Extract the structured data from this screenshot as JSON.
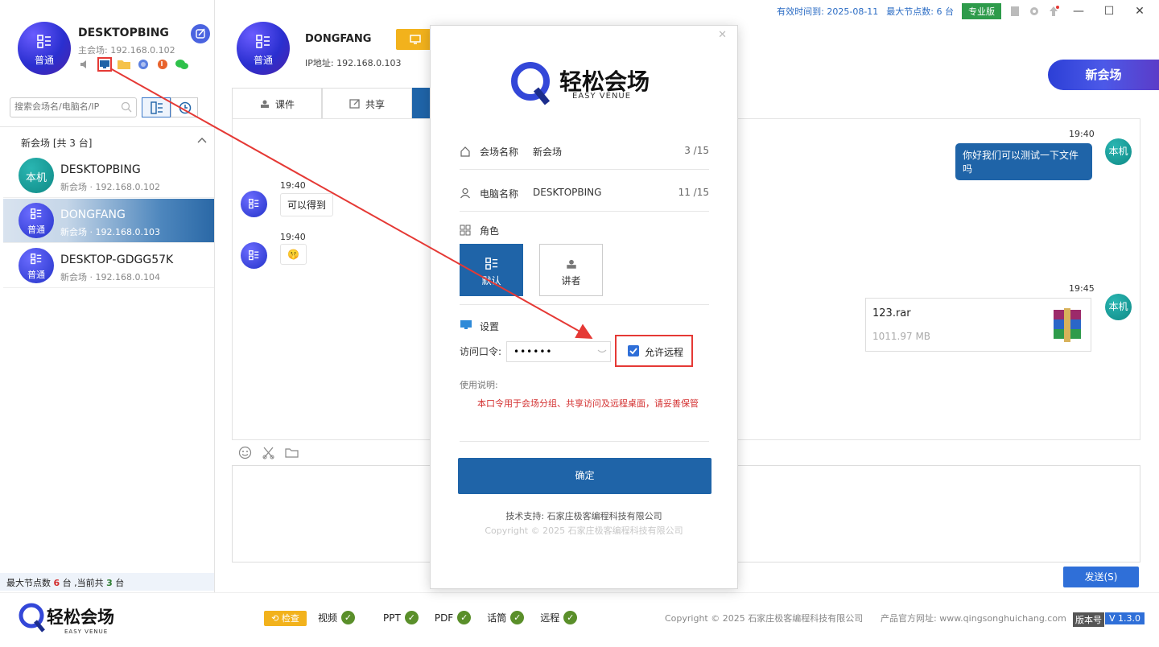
{
  "topbar": {
    "expiry": "有效时间到: 2025-08-11",
    "max_nodes": "最大节点数: 6 台",
    "edition": "专业版"
  },
  "host": {
    "name": "DESKTOPBING",
    "sub": "主会场: 192.168.0.102",
    "avatar_label": "普通"
  },
  "search": {
    "placeholder": "搜索会场名/电脑名/IP"
  },
  "group": {
    "title": "新会场   [共 3 台]"
  },
  "devices": [
    {
      "avatar": "本机",
      "name": "DESKTOPBING",
      "sub": "新会场 · 192.168.0.102"
    },
    {
      "avatar": "普通",
      "name": "DONGFANG",
      "sub": "新会场 · 192.168.0.103"
    },
    {
      "avatar": "普通",
      "name": "DESKTOP-GDGG57K",
      "sub": "新会场 · 192.168.0.104"
    }
  ],
  "footer_left": {
    "prefix": "最大节点数 ",
    "max": "6",
    "mid": " 台 ,当前共 ",
    "cur": "3",
    "suffix": " 台"
  },
  "peer": {
    "name": "DONGFANG",
    "ip": "IP地址: 192.168.0.103",
    "avatar_label": "普通"
  },
  "new_venue_button": "新会场",
  "tabs": [
    {
      "label": "课件"
    },
    {
      "label": "共享"
    }
  ],
  "messages": [
    {
      "time": "19:40",
      "text": "你好我们可以测试一下文件吗",
      "avatar": "本机"
    },
    {
      "time": "19:40",
      "text": "可以得到"
    },
    {
      "time": "19:40",
      "text": "🤫"
    },
    {
      "time": "19:45",
      "file_name": "123.rar",
      "file_size": "1011.97 MB",
      "avatar": "本机"
    }
  ],
  "send_button": "发送(S)",
  "bottom": {
    "check_button": "检查",
    "checks": [
      "视频",
      "PPT",
      "PDF",
      "话筒",
      "远程"
    ],
    "copyright": "Copyright © 2025 石家庄极客编程科技有限公司",
    "website": "产品官方网址: www.qingsonghuichang.com",
    "version_label": "版本号",
    "version": "V 1.3.0"
  },
  "logo": {
    "cn": "轻松会场",
    "en": "EASY VENUE"
  },
  "modal": {
    "venue_label": "会场名称",
    "venue_value": "新会场",
    "venue_count": "3 /15",
    "pc_label": "电脑名称",
    "pc_value": "DESKTOPBING",
    "pc_count": "11 /15",
    "role_title": "角色",
    "role_default": "默认",
    "role_speaker": "讲者",
    "settings_title": "设置",
    "password_label": "访问口令:",
    "password_value": "••••••",
    "allow_remote": "允许远程",
    "notice_title": "使用说明:",
    "notice_text": "本口令用于会场分组、共享访问及远程桌面，请妥善保管",
    "ok_button": "确定",
    "support": "技术支持: 石家庄极客编程科技有限公司",
    "copyright": "Copyright © 2025 石家庄极客编程科技有限公司"
  },
  "colors": {
    "accent": "#1f64a8",
    "highlight": "#e53935",
    "gold": "#f2b21c"
  }
}
